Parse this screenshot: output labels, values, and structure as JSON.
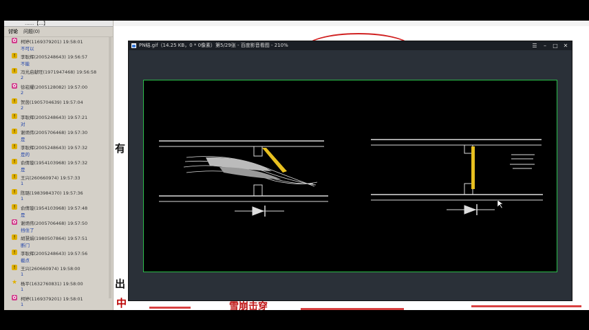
{
  "chat": {
    "header_text": "......【...】",
    "tabs": [
      {
        "label": "讨论"
      },
      {
        "label": "问题"
      },
      {
        "label": "(0)"
      }
    ],
    "messages": [
      {
        "icon": "gift-icon",
        "name_time": "柯婷(1169379201) 19:58:01",
        "text": "不可以"
      },
      {
        "icon": "warn-icon",
        "name_time": "李耿辉(2005248643) 19:56:57",
        "text": "不能"
      },
      {
        "icon": "warn-icon",
        "name_time": "冯光启献旺(1971947468) 19:56:58",
        "text": "2"
      },
      {
        "icon": "gift-icon",
        "name_time": "徐崧耀(2005128082) 19:57:00",
        "text": "2"
      },
      {
        "icon": "warn-icon",
        "name_time": "贺茵(1905704639) 19:57:04",
        "text": "2"
      },
      {
        "icon": "warn-icon",
        "name_time": "李耿辉(2005248643) 19:57:21",
        "text": "对"
      },
      {
        "icon": "warn-icon",
        "name_time": "谢炳伟(2005706468) 19:57:30",
        "text": "是"
      },
      {
        "icon": "warn-icon",
        "name_time": "李耿辉(2005248643) 19:57:32",
        "text": "是的"
      },
      {
        "icon": "warn-icon",
        "name_time": "俞倩璇(1954103968) 19:57:32",
        "text": "是"
      },
      {
        "icon": "warn-icon",
        "name_time": "王兴(260660974) 19:57:33",
        "text": "1"
      },
      {
        "icon": "warn-icon",
        "name_time": "陈璐(1983984370) 19:57:36",
        "text": "1"
      },
      {
        "icon": "warn-icon",
        "name_time": "俞倩璇(1954103968) 19:57:48",
        "text": "是"
      },
      {
        "icon": "gift-icon",
        "name_time": "谢炳伟(2005706468) 19:57:50",
        "text": "挡住了"
      },
      {
        "icon": "warn-icon",
        "name_time": "胡慧娟(1980507864) 19:57:51",
        "text": "断门"
      },
      {
        "icon": "warn-icon",
        "name_time": "李耿辉(2005248643) 19:57:56",
        "text": "截点"
      },
      {
        "icon": "warn-icon",
        "name_time": "王兴(260660974) 19:58:00",
        "text": "1"
      },
      {
        "icon": "star-icon",
        "name_time": "杨平(1632760831) 19:58:00",
        "text": "1"
      },
      {
        "icon": "gift-icon",
        "name_time": "柯婷(1169379201) 19:58:01",
        "text": "1"
      }
    ]
  },
  "slide": {
    "side_char_1": "有",
    "side_char_2": "出",
    "side_char_3": "中",
    "red_caption": "雪崩击穿"
  },
  "viewer": {
    "title": "PN结.gif（14.25 KB，0 * 0像素）第5/29张 - 百度影音看图 - 210%",
    "window_controls": [
      {
        "name": "menu",
        "glyph": "☰"
      },
      {
        "name": "minimize",
        "glyph": "–"
      },
      {
        "name": "maximize",
        "glyph": "□"
      },
      {
        "name": "close",
        "glyph": "✕"
      }
    ]
  },
  "colors": {
    "chat_bg": "#d4d0c8",
    "viewer_bg": "#2a3038",
    "canvas_border": "#2bbf4a",
    "accent_yellow": "#e8c020",
    "red": "#d02020"
  }
}
